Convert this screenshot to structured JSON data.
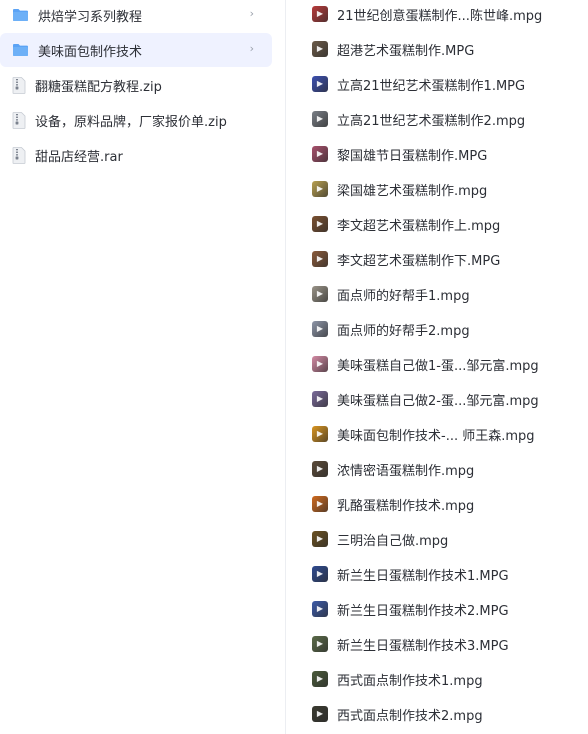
{
  "left_list": {
    "items": [
      {
        "type": "folder",
        "label": "烘焙学习系列教程",
        "chevron": "›",
        "selected": false
      },
      {
        "type": "folder",
        "label": "美味面包制作技术",
        "chevron": "›",
        "selected": true
      },
      {
        "type": "zip",
        "label": "翻糖蛋糕配方教程.zip"
      },
      {
        "type": "zip",
        "label": "设备，原料品牌，厂家报价单.zip"
      },
      {
        "type": "zip",
        "label": "甜品店经营.rar"
      }
    ]
  },
  "right_list": {
    "items": [
      {
        "label": "21世纪创意蛋糕制作...陈世峰.mpg",
        "thumb_color": "#b83a3a"
      },
      {
        "label": "超港艺术蛋糕制作.MPG",
        "thumb_color": "#6b5a48"
      },
      {
        "label": "立高21世纪艺术蛋糕制作1.MPG",
        "thumb_color": "#3c4fb0"
      },
      {
        "label": "立高21世纪艺术蛋糕制作2.mpg",
        "thumb_color": "#7a7f86"
      },
      {
        "label": "黎国雄节日蛋糕制作.MPG",
        "thumb_color": "#a8506c"
      },
      {
        "label": "梁国雄艺术蛋糕制作.mpg",
        "thumb_color": "#b8a050"
      },
      {
        "label": "李文超艺术蛋糕制作上.mpg",
        "thumb_color": "#7a5030"
      },
      {
        "label": "李文超艺术蛋糕制作下.MPG",
        "thumb_color": "#8a5a3a"
      },
      {
        "label": "面点师的好帮手1.mpg",
        "thumb_color": "#9a9488"
      },
      {
        "label": "面点师的好帮手2.mpg",
        "thumb_color": "#8e96a8"
      },
      {
        "label": "美味蛋糕自己做1-蛋...邹元富.mpg",
        "thumb_color": "#d48aa4"
      },
      {
        "label": "美味蛋糕自己做2-蛋...邹元富.mpg",
        "thumb_color": "#7a6a9a"
      },
      {
        "label": "美味面包制作技术-... 师王森.mpg",
        "thumb_color": "#d99520"
      },
      {
        "label": "浓情密语蛋糕制作.mpg",
        "thumb_color": "#5a4a38"
      },
      {
        "label": "乳酪蛋糕制作技术.mpg",
        "thumb_color": "#d06a1e"
      },
      {
        "label": "三明治自己做.mpg",
        "thumb_color": "#6a5020"
      },
      {
        "label": "新兰生日蛋糕制作技术1.MPG",
        "thumb_color": "#2e4a90"
      },
      {
        "label": "新兰生日蛋糕制作技术2.MPG",
        "thumb_color": "#3c5aa8"
      },
      {
        "label": "新兰生日蛋糕制作技术3.MPG",
        "thumb_color": "#5a6a48"
      },
      {
        "label": "西式面点制作技术1.mpg",
        "thumb_color": "#4a5a3a"
      },
      {
        "label": "西式面点制作技术2.mpg",
        "thumb_color": "#3a3a30"
      }
    ]
  },
  "colors": {
    "selected_bg": "#eff2ff",
    "folder_icon": "#5ba3f5",
    "text": "#2c2f36"
  },
  "icons": {
    "folder": "folder-icon",
    "zip": "zip-file-icon",
    "video": "video-thumbnail-icon",
    "chevron": "chevron-right-icon"
  }
}
